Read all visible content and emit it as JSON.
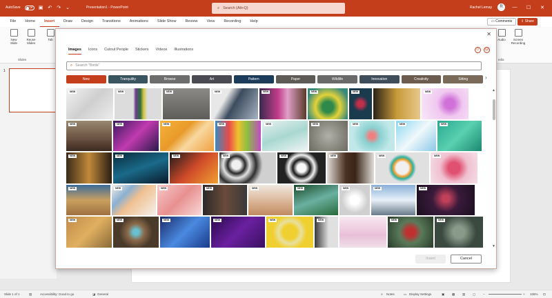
{
  "titlebar": {
    "autosave": "AutoSave",
    "toggle": "Off",
    "doc_title": "Presentation1 - PowerPoint",
    "search_placeholder": "Search (Alt+Q)",
    "user": "Rachel Lemay",
    "user_initial": "R"
  },
  "tabs": [
    "File",
    "Home",
    "Insert",
    "Draw",
    "Design",
    "Transitions",
    "Animations",
    "Slide Show",
    "Review",
    "View",
    "Recording",
    "Help"
  ],
  "active_tab": "Insert",
  "comments": "Comments",
  "share": "Share",
  "ribbon": {
    "new_slide": "New Slide",
    "reuse_slides": "Reuse Slides",
    "slides_group": "Slides",
    "table": "Tab",
    "audio": "Audio",
    "screen_recording": "Screen Recording",
    "media_group": "edia"
  },
  "slide_number": "1",
  "status": {
    "slide": "Slide 1 of 1",
    "accessibility": "Accessibility: Good to go",
    "general": "General",
    "notes": "Notes",
    "display": "Display Settings",
    "zoom": "106%"
  },
  "dialog": {
    "tabs": [
      "Images",
      "Icons",
      "Cutout People",
      "Stickers",
      "Videos",
      "Illustrations"
    ],
    "active_tab": "Images",
    "search_placeholder": "Search \"Birds\"",
    "chips": [
      "New",
      "Tranquility",
      "Browse",
      "Art",
      "Pattern",
      "Paper",
      "Wildlife",
      "Innovation",
      "Creativity",
      "Sitting"
    ],
    "active_chip": "New",
    "badge": "NEW",
    "insert": "Insert",
    "cancel": "Cancel"
  },
  "colors": {
    "accent": "#c43e1c"
  }
}
